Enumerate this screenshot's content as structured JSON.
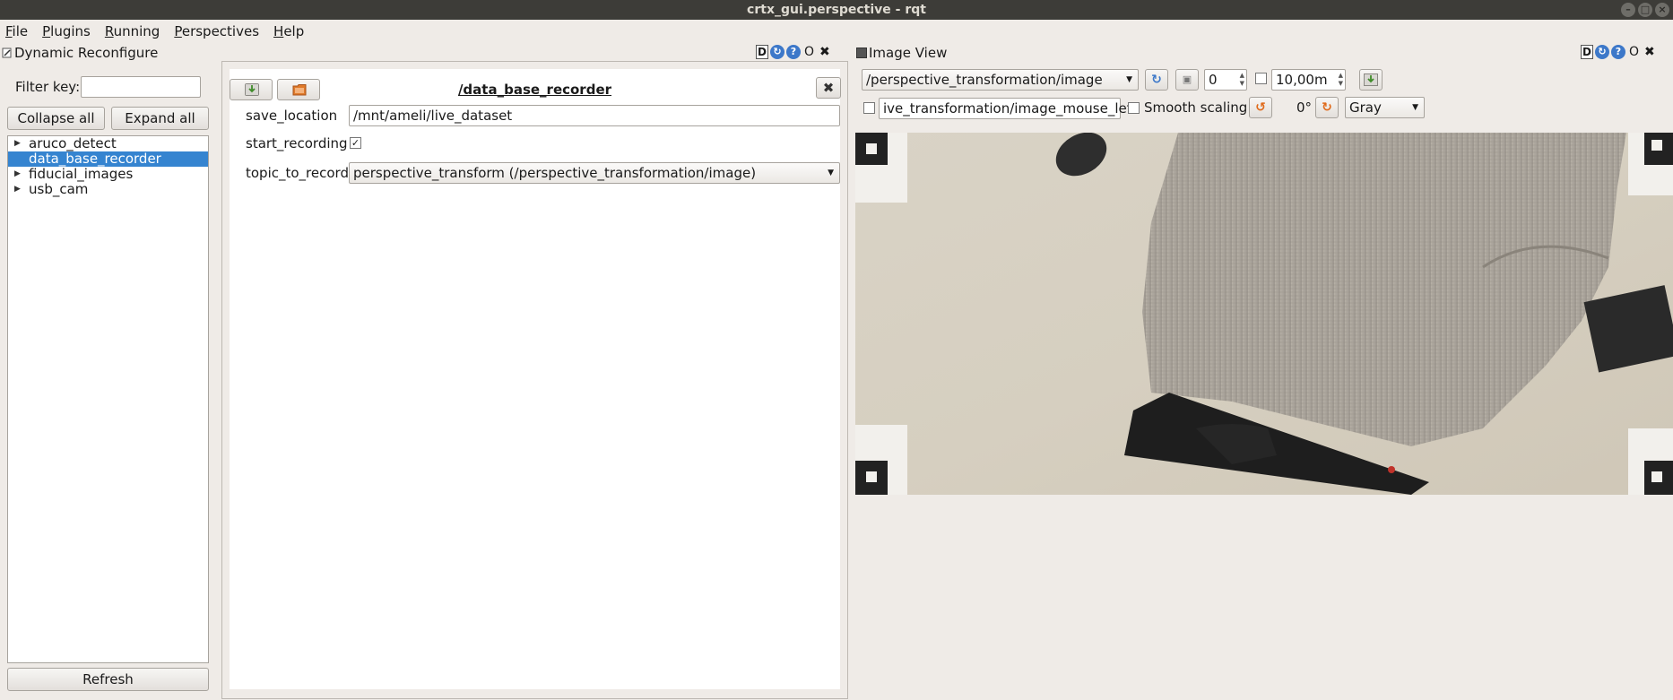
{
  "window": {
    "title": "crtx_gui.perspective - rqt",
    "buttons": [
      "–",
      "□",
      "×"
    ]
  },
  "menubar": {
    "items": [
      "File",
      "Plugins",
      "Running",
      "Perspectives",
      "Help"
    ]
  },
  "dynamic_reconfigure": {
    "title": "Dynamic Reconfigure",
    "controls": {
      "d": "D",
      "help": "?",
      "reload": "↻",
      "float": "O",
      "close": "✖"
    },
    "filter_label": "Filter key:",
    "filter_value": "",
    "collapse_label": "Collapse all",
    "expand_label": "Expand all",
    "tree": [
      {
        "label": "aruco_detect",
        "selected": false
      },
      {
        "label": "data_base_recorder",
        "selected": true
      },
      {
        "label": "fiducial_images",
        "selected": false
      },
      {
        "label": "usb_cam",
        "selected": false
      }
    ],
    "refresh_label": "Refresh",
    "node": {
      "title": "/data_base_recorder",
      "close": "✖",
      "params": {
        "save_location": {
          "label": "save_location",
          "value": "/mnt/ameli/live_dataset"
        },
        "start_recording": {
          "label": "start_recording",
          "checked": true,
          "mark": "✓"
        },
        "topic_to_record": {
          "label": "topic_to_record",
          "value": "perspective_transform (/perspective_transformation/image)"
        }
      }
    }
  },
  "image_view": {
    "title": "Image View",
    "controls": {
      "d": "D",
      "help": "?",
      "reload": "↻",
      "float": "O",
      "close": "✖"
    },
    "topic": "/perspective_transformation/image",
    "refresh_icon": "refresh-icon",
    "zoom_value": "0",
    "max_value": "10,00m",
    "mouse_topic": "ive_transformation/image_mouse_left",
    "smooth_label": "Smooth scaling",
    "rotation": "0°",
    "colormap": "Gray"
  },
  "colors": {
    "selection": "#3584d0",
    "titlebar": "#3d3c38",
    "background": "#efebe7",
    "accent_orange": "#e06a1b"
  }
}
